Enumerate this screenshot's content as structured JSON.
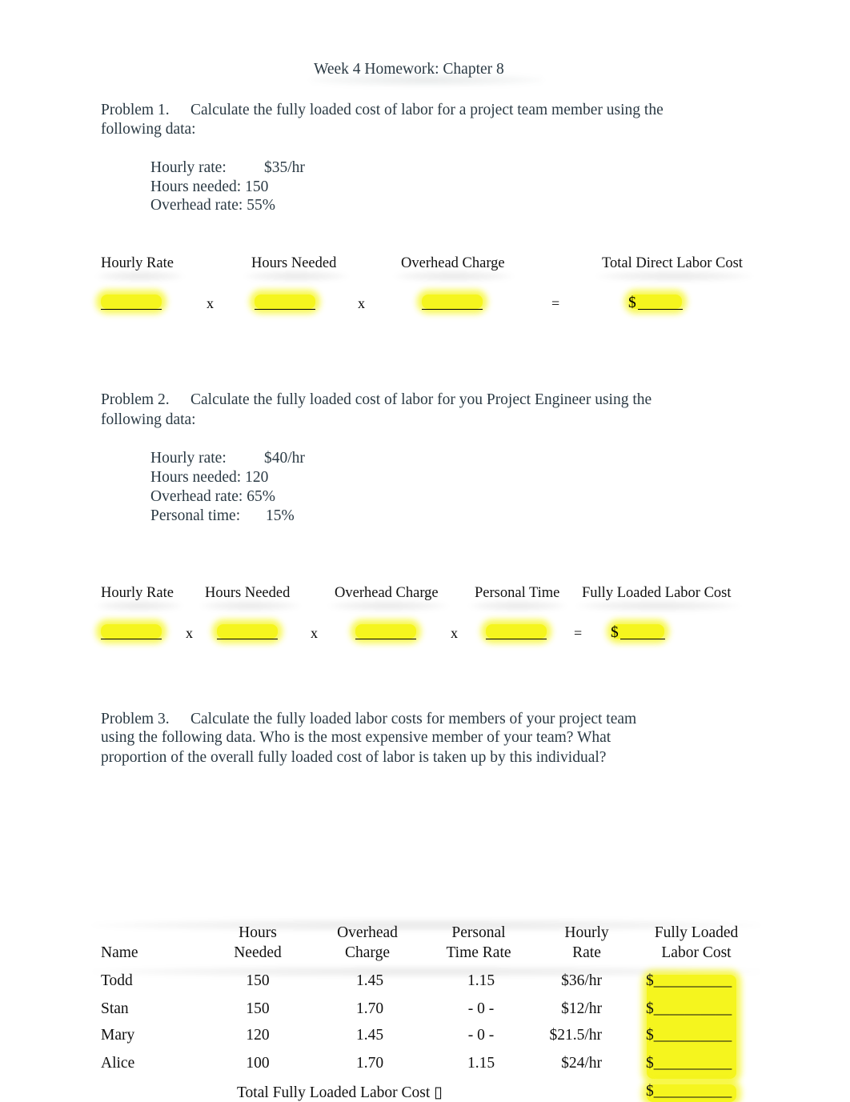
{
  "title": "Week 4 Homework: Chapter 8",
  "problem1": {
    "label": "Problem 1.",
    "text_line1": "Calculate the fully loaded cost of labor for a project team member using the",
    "text_line2": "following data:",
    "data": [
      {
        "label": "Hourly rate:",
        "value": "$35/hr"
      },
      {
        "label": "Hours needed:",
        "value": "150"
      },
      {
        "label": "Overhead rate:",
        "value": "55%"
      }
    ],
    "formula_headers": [
      "Hourly Rate",
      "Hours Needed",
      "Overhead Charge",
      "Total Direct Labor Cost"
    ],
    "operators": [
      "x",
      "x",
      "="
    ],
    "dollar_sign": "$",
    "blank": "________",
    "blank_result": "______"
  },
  "problem2": {
    "label": "Problem 2.",
    "text_line1": "Calculate the fully loaded cost of labor for you Project Engineer using the",
    "text_line2": "following data:",
    "data": [
      {
        "label": "Hourly rate:",
        "value": "$40/hr"
      },
      {
        "label": "Hours needed:",
        "value": "120"
      },
      {
        "label": "Overhead rate:",
        "value": "65%"
      },
      {
        "label": "Personal time:",
        "value": "15%"
      }
    ],
    "formula_headers": [
      "Hourly Rate",
      "Hours Needed",
      "Overhead Charge",
      "Personal Time",
      "Fully Loaded Labor Cost"
    ],
    "operators": [
      "x",
      "x",
      "x",
      "="
    ],
    "dollar_sign": "$",
    "blank": "________",
    "blank_result": "______"
  },
  "problem3": {
    "label": "Problem 3.",
    "text_line1": "Calculate the fully loaded labor costs for members of your project team",
    "text_line2": "using the following data. Who is the most expensive member of your team? What",
    "text_line3": "proportion of the overall fully loaded cost of labor is taken up by this individual?",
    "table": {
      "headers": [
        {
          "line1": "",
          "line2": "Name"
        },
        {
          "line1": "Hours",
          "line2": "Needed"
        },
        {
          "line1": "Overhead",
          "line2": "Charge"
        },
        {
          "line1": "Personal",
          "line2": "Time Rate"
        },
        {
          "line1": "Hourly",
          "line2": "Rate"
        },
        {
          "line1": "Fully Loaded",
          "line2": "Labor Cost"
        }
      ],
      "rows": [
        {
          "name": "Todd",
          "hours": "150",
          "overhead": "1.45",
          "personal": "1.15",
          "rate": "$36/hr",
          "cost": "$__________"
        },
        {
          "name": "Stan",
          "hours": "150",
          "overhead": "1.70",
          "personal": "- 0 -",
          "rate": "$12/hr",
          "cost": "$__________"
        },
        {
          "name": "Mary",
          "hours": "120",
          "overhead": "1.45",
          "personal": "- 0 -",
          "rate": "$21.5/hr",
          "cost": "$__________"
        },
        {
          "name": "Alice",
          "hours": "100",
          "overhead": "1.70",
          "personal": "1.15",
          "rate": "$24/hr",
          "cost": "$__________"
        }
      ],
      "total_label": "Total Fully Loaded Labor Cost ▯",
      "total_cost": "$__________"
    }
  }
}
